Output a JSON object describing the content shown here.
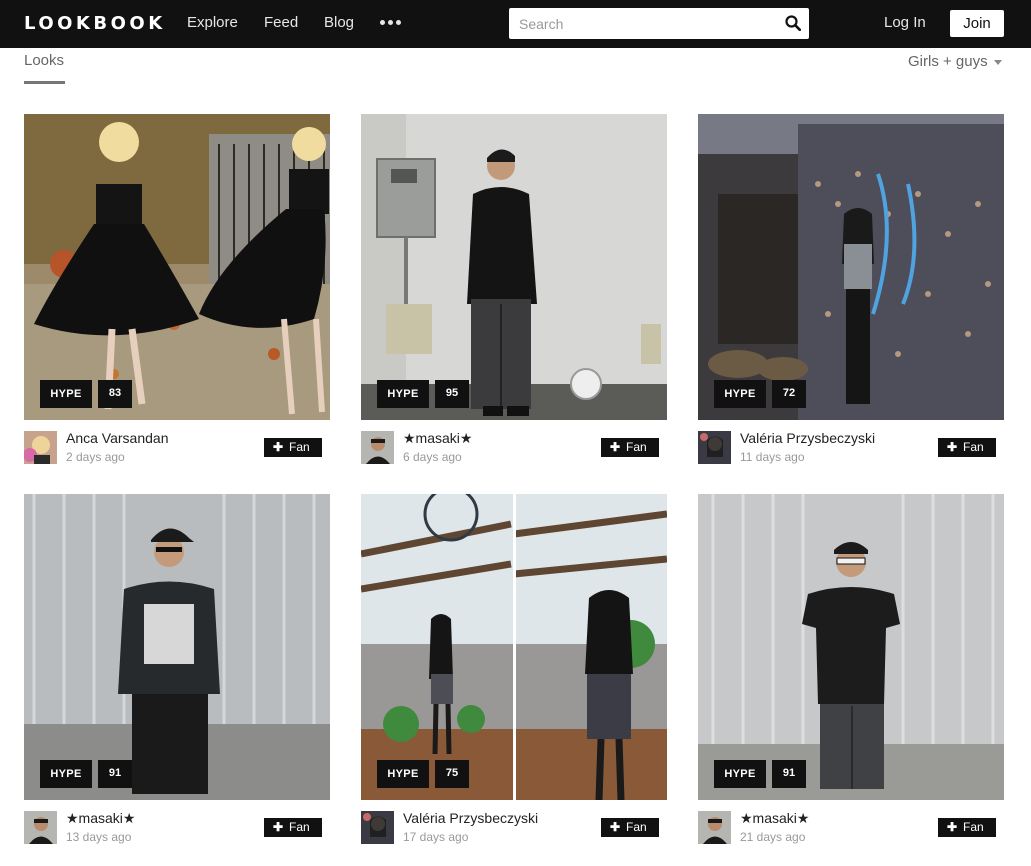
{
  "header": {
    "logo": "LOOKBOOK",
    "nav": [
      "Explore",
      "Feed",
      "Blog"
    ],
    "more_icon": "more-dots-icon",
    "search": {
      "placeholder": "Search",
      "value": "",
      "icon": "search-icon"
    },
    "login": "Log In",
    "join": "Join"
  },
  "subheader": {
    "tab": "Looks",
    "filter": "Girls + guys",
    "filter_icon": "caret-down-icon"
  },
  "looks": [
    {
      "hype_label": "HYPE",
      "hype_count": "83",
      "author": "Anca Varsandan",
      "posted": "2 days ago",
      "fan_label": "Fan"
    },
    {
      "hype_label": "HYPE",
      "hype_count": "95",
      "author": "★masaki★",
      "posted": "6 days ago",
      "fan_label": "Fan"
    },
    {
      "hype_label": "HYPE",
      "hype_count": "72",
      "author": "Valéria Przysbeczyski",
      "posted": "11 days ago",
      "fan_label": "Fan"
    },
    {
      "hype_label": "HYPE",
      "hype_count": "91",
      "author": "★masaki★",
      "posted": "13 days ago",
      "fan_label": "Fan"
    },
    {
      "hype_label": "HYPE",
      "hype_count": "75",
      "author": "Valéria Przysbeczyski",
      "posted": "17 days ago",
      "fan_label": "Fan"
    },
    {
      "hype_label": "HYPE",
      "hype_count": "91",
      "author": "★masaki★",
      "posted": "21 days ago",
      "fan_label": "Fan"
    }
  ],
  "colors": {
    "header_bg": "#111111",
    "badge_bg": "#111111",
    "muted_text": "#999999"
  }
}
